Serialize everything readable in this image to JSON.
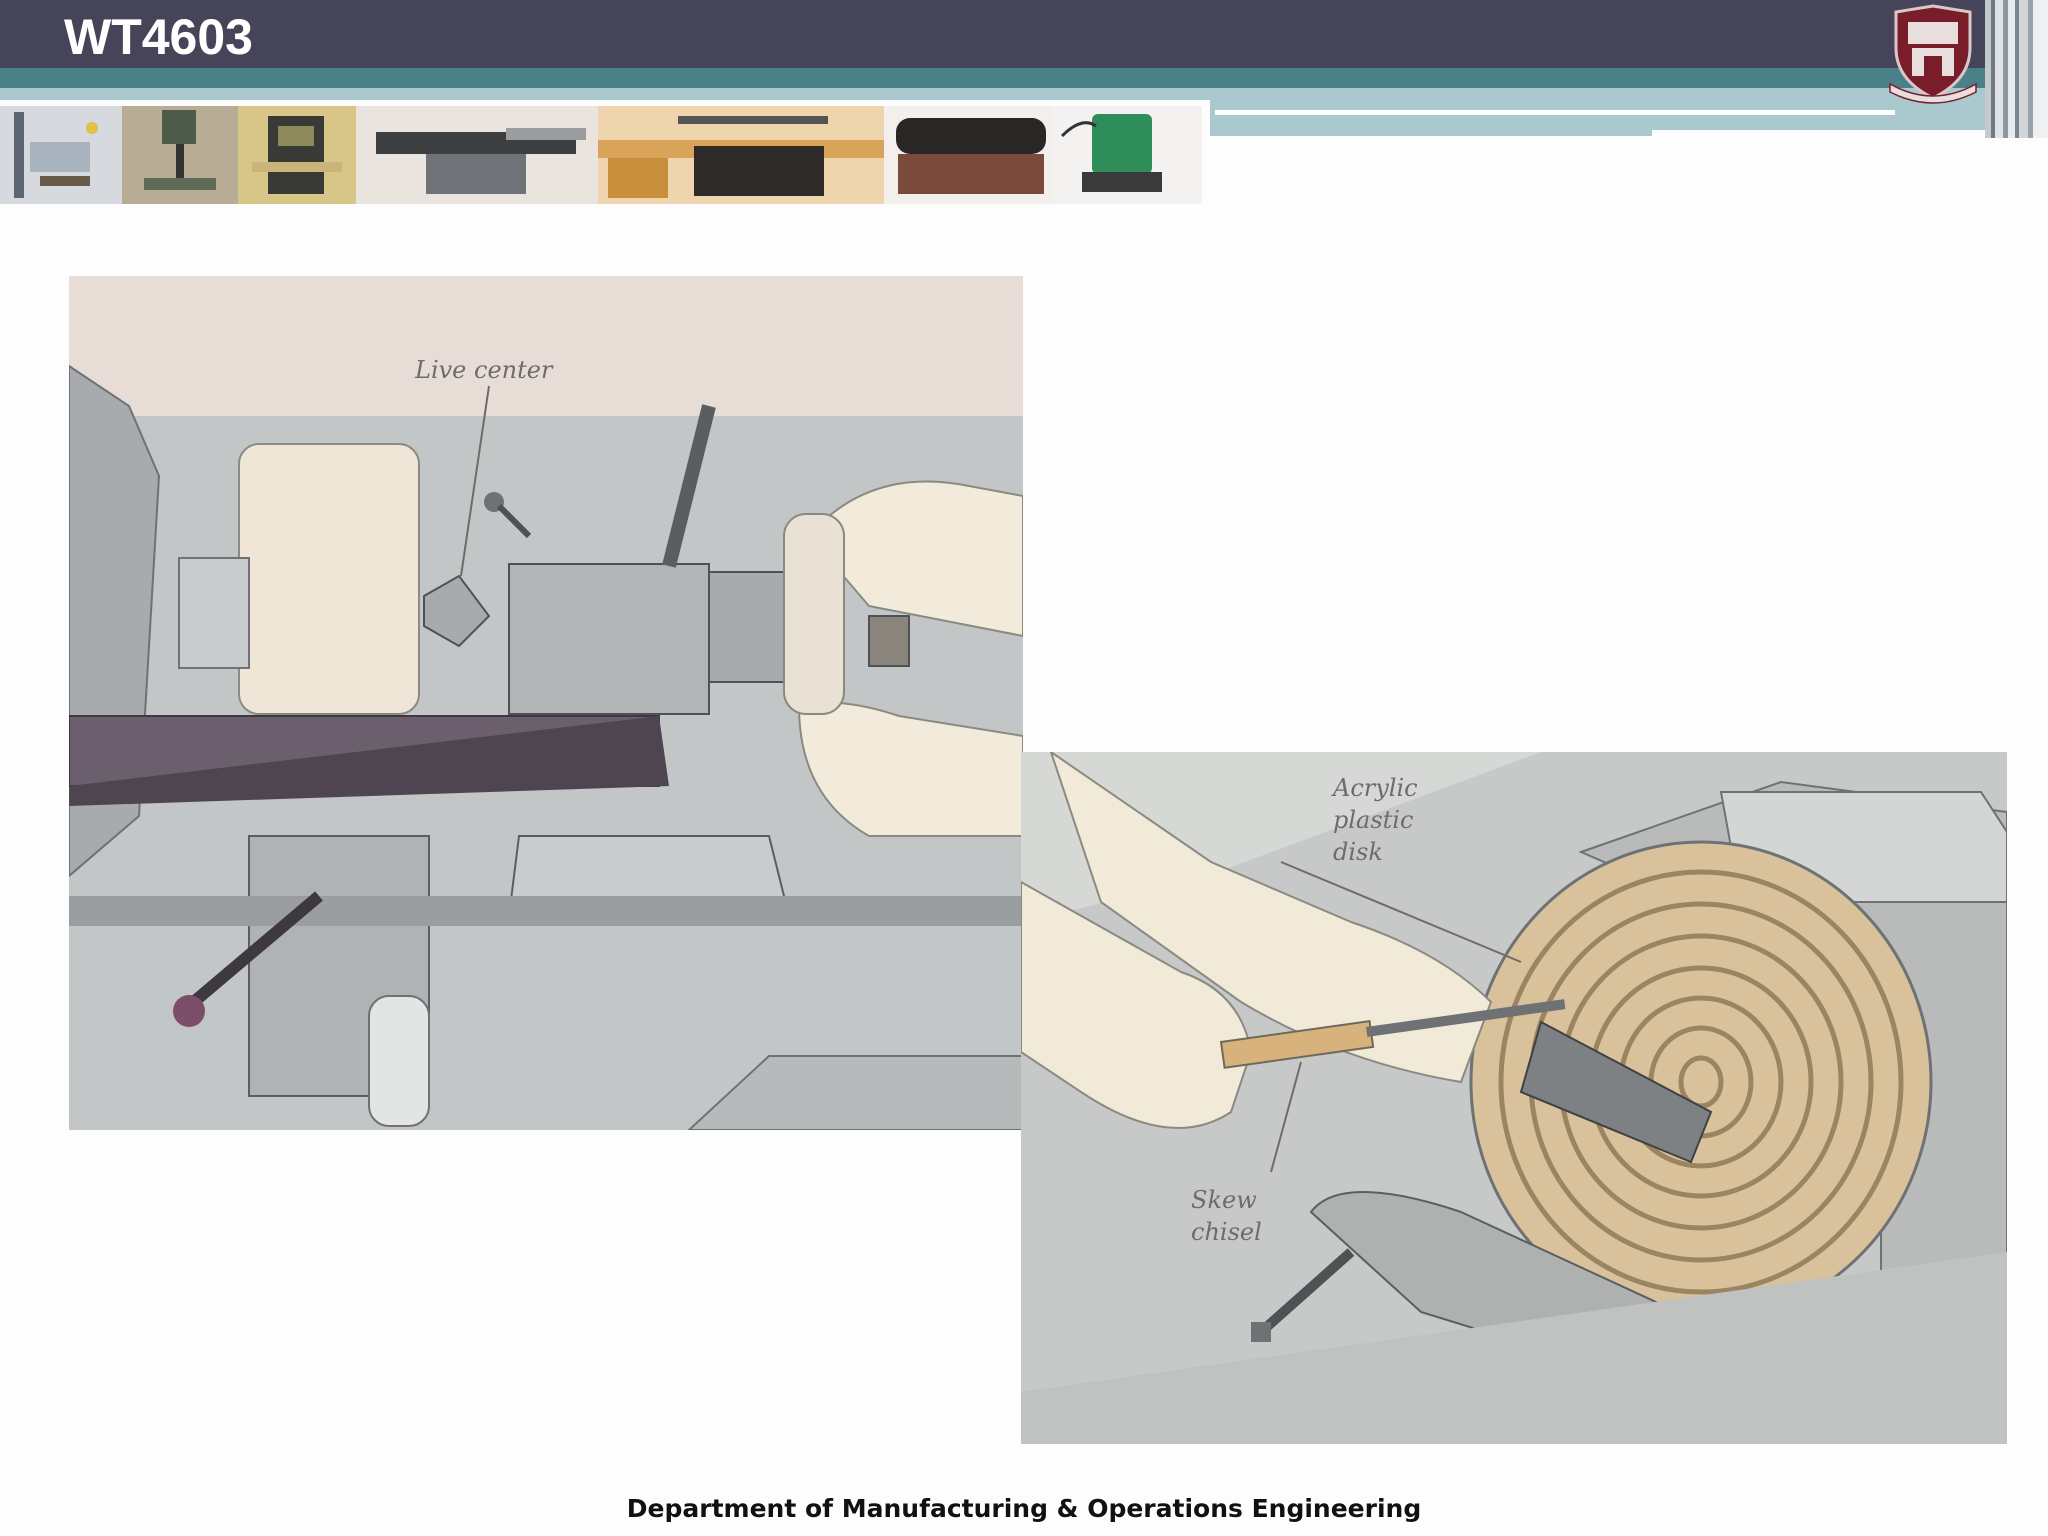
{
  "slide": {
    "title": "WT4603",
    "footer": "Department of Manufacturing & Operations Engineering"
  },
  "header": {
    "crest_icon": "university-crest-icon",
    "photo_strip": [
      "drill-press-photo",
      "bench-drill-photo",
      "bandsaw-photo",
      "planer-thicknesser-photo",
      "table-saw-photo",
      "mitre-saw-photo",
      "router-photo"
    ]
  },
  "figure_left": {
    "labels": {
      "live_center": "Live center"
    }
  },
  "figure_right": {
    "labels": {
      "disk_line1": "Acrylic",
      "disk_line2": "plastic",
      "disk_line3": "disk",
      "chisel_line1": "Skew",
      "chisel_line2": "chisel"
    }
  },
  "colors": {
    "header": "#454459",
    "teal": "#4a8189",
    "teal_light": "#a9c9ce"
  }
}
